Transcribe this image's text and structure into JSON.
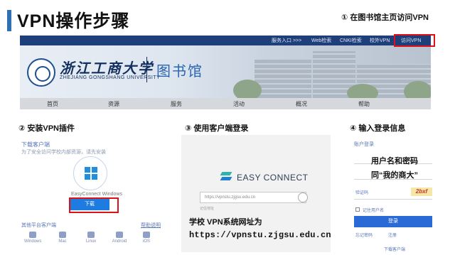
{
  "title": "VPN操作步骤",
  "steps": {
    "s1": "① 在图书馆主页访问VPN",
    "s2": "② 安装VPN插件",
    "s3": "③ 使用客户端登录",
    "s4": "④ 输入登录信息"
  },
  "site": {
    "topnav": [
      "服务入口 >>>",
      "Web检索",
      "CNKI检索",
      "校外VPN",
      "访问VPN"
    ],
    "university_cn": "浙江工商大学",
    "university_en": "ZHEJIANG GONGSHANG UNIVERSITY",
    "library": "图书馆",
    "mainnav": [
      "首页",
      "资源",
      "服务",
      "活动",
      "概况",
      "帮助"
    ]
  },
  "panel2": {
    "heading": "下载客户端",
    "sub": "为了安全访问学校内部资源，请先安装",
    "os_label": "EasyConnect Windows",
    "download_button": "下载",
    "other_label": "其他平台客户端",
    "help_link": "帮助说明",
    "platforms": [
      "Windows",
      "Mac",
      "Linux",
      "Android",
      "iOS"
    ]
  },
  "panel3": {
    "app_name": "EASY CONNECT",
    "input_value": "https://vpnstu.zjgsu.edu.cn",
    "small_text": "记住地址",
    "line1": "学校 VPN系统网址为",
    "line2": "https://vpnstu.zjgsu.edu.cn"
  },
  "panel4": {
    "heading": "账户登录",
    "note1": "用户名和密码",
    "note2": "同“我的商大”",
    "captcha_label": "验证码",
    "captcha": "2bxf",
    "remember": "记住用户名",
    "login_button": "登录",
    "links": [
      "忘记密码",
      "注册"
    ],
    "footer": "下载客户端"
  },
  "colors": {
    "accent": "#2f6fb3",
    "highlight": "#e0101a",
    "nav_dark": "#1f3f7a",
    "button_blue": "#1e7be0"
  }
}
